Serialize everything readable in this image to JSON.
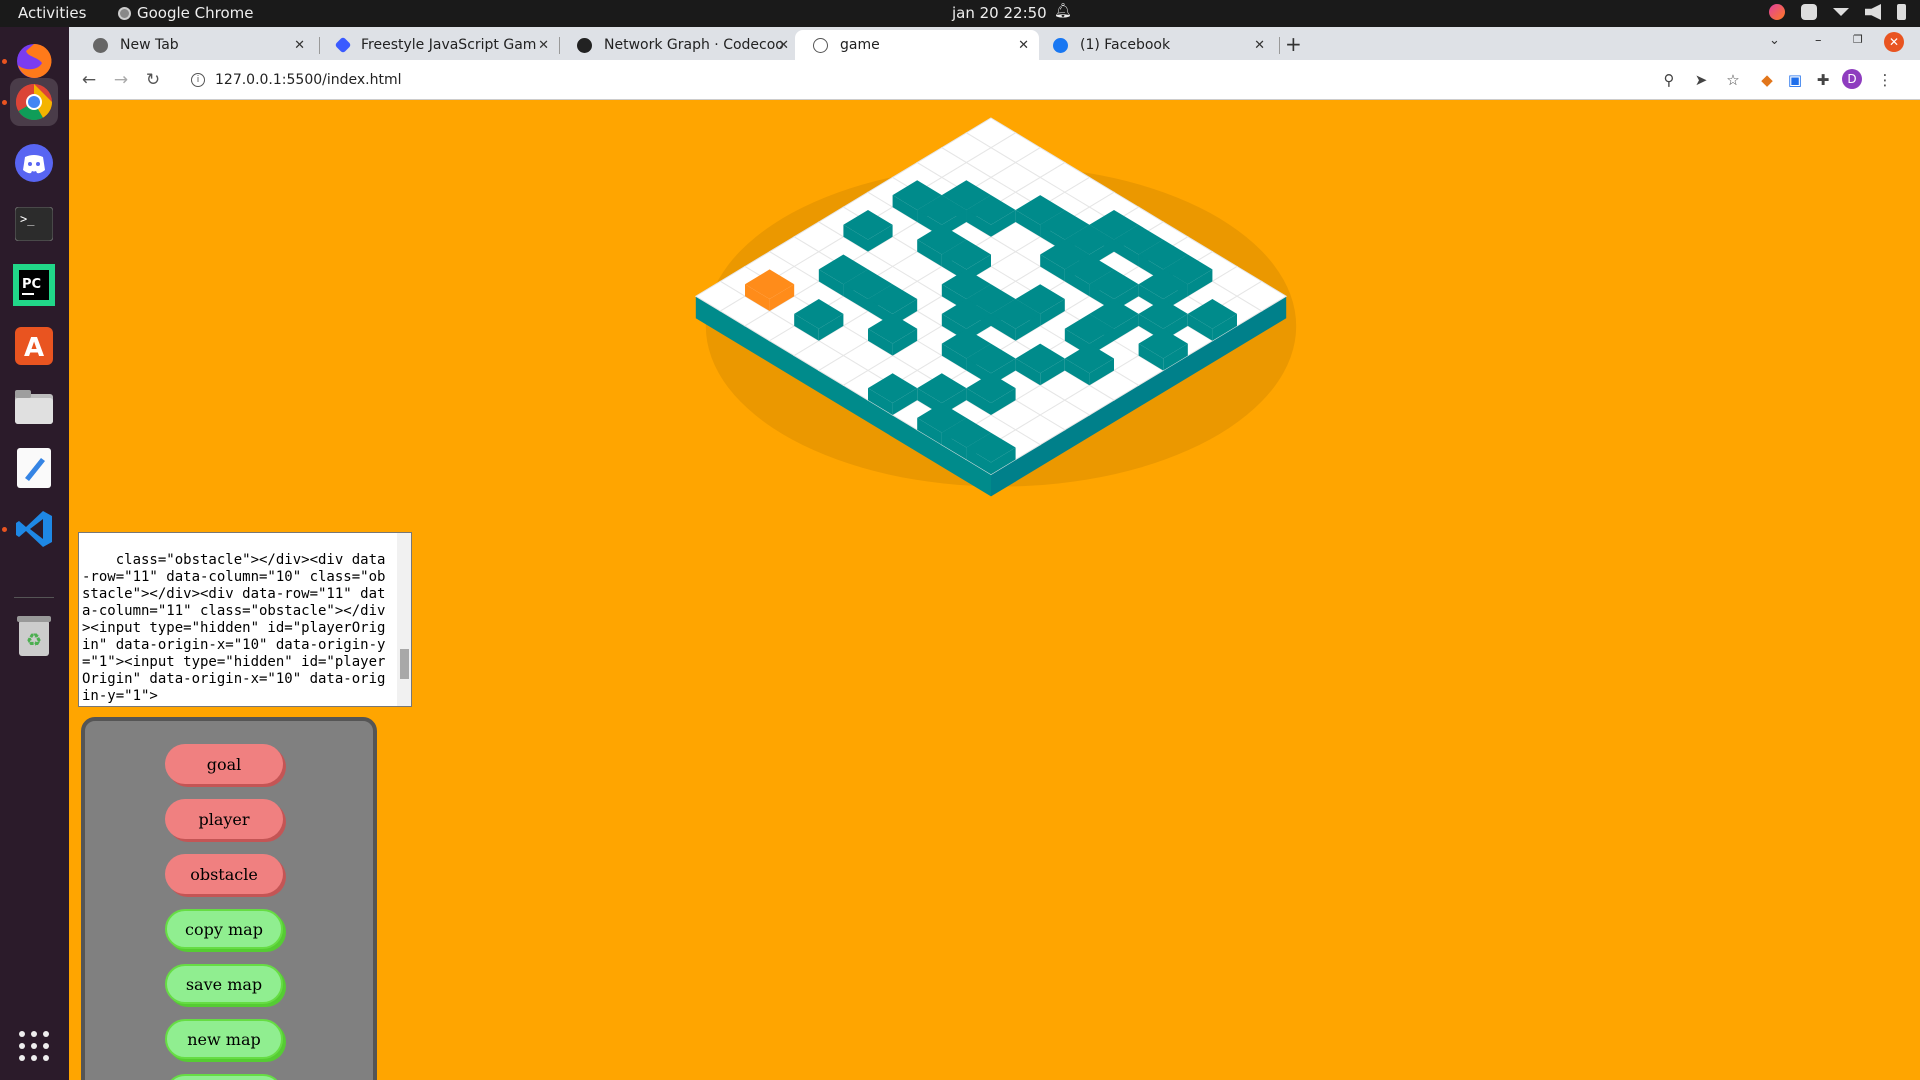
{
  "topbar": {
    "activities": "Activities",
    "app_name": "Google Chrome",
    "clock": "jan 20  22:50"
  },
  "dock": {
    "items": [
      "firefox-icon",
      "chrome-icon",
      "discord-icon",
      "terminal-icon",
      "pycharm-icon",
      "software-center-icon",
      "files-icon",
      "text-editor-icon",
      "vscode-icon",
      "trash-icon",
      "app-grid-icon"
    ]
  },
  "browser": {
    "tabs": [
      {
        "title": "New Tab",
        "icon": "chrome-tab-icon"
      },
      {
        "title": "Freestyle JavaScript Gam",
        "icon": "codecademy-icon"
      },
      {
        "title": "Network Graph · Codecoo",
        "icon": "github-icon"
      },
      {
        "title": "game",
        "icon": "globe-icon",
        "active": true
      },
      {
        "title": "(1) Facebook",
        "icon": "facebook-icon"
      }
    ],
    "new_tab": "+",
    "url": "127.0.0.1:5500/index.html",
    "profile_initial": "D"
  },
  "page": {
    "background": "#ffa500",
    "board": {
      "size": 12,
      "colors": {
        "floor": "#ffffff",
        "grid": "#e6e6e6",
        "wall": "#008b8b",
        "side": "#00808a",
        "player": "#ff8c1a"
      },
      "player": {
        "row": 10,
        "col": 1
      },
      "obstacles": [
        [
          1,
          6
        ],
        [
          1,
          7
        ],
        [
          1,
          8
        ],
        [
          1,
          9
        ],
        [
          2,
          4
        ],
        [
          2,
          5
        ],
        [
          2,
          6
        ],
        [
          2,
          9
        ],
        [
          2,
          11
        ],
        [
          3,
          2
        ],
        [
          3,
          3
        ],
        [
          3,
          6
        ],
        [
          3,
          7
        ],
        [
          3,
          8
        ],
        [
          3,
          10
        ],
        [
          4,
          1
        ],
        [
          4,
          2
        ],
        [
          4,
          9
        ],
        [
          4,
          11
        ],
        [
          5,
          3
        ],
        [
          5,
          4
        ],
        [
          5,
          7
        ],
        [
          5,
          9
        ],
        [
          6,
          1
        ],
        [
          6,
          5
        ],
        [
          6,
          6
        ],
        [
          6,
          7
        ],
        [
          6,
          10
        ],
        [
          7,
          6
        ],
        [
          7,
          9
        ],
        [
          8,
          2
        ],
        [
          8,
          3
        ],
        [
          8,
          4
        ],
        [
          8,
          7
        ],
        [
          8,
          8
        ],
        [
          9,
          5
        ],
        [
          9,
          9
        ],
        [
          10,
          3
        ],
        [
          10,
          8
        ],
        [
          11,
          7
        ],
        [
          11,
          9
        ],
        [
          11,
          10
        ],
        [
          11,
          11
        ]
      ]
    },
    "map_code": "class=\"obstacle\"></div><div data-row=\"11\" data-column=\"10\" class=\"obstacle\"></div><div data-row=\"11\" data-column=\"11\" class=\"obstacle\"></div><input type=\"hidden\" id=\"playerOrigin\" data-origin-x=\"10\" data-origin-y=\"1\"><input type=\"hidden\" id=\"playerOrigin\" data-origin-x=\"10\" data-origin-y=\"1\">",
    "palette": {
      "goal": "goal",
      "player": "player",
      "obstacle": "obstacle",
      "copy_map": "copy map",
      "save_map": "save map",
      "new_map": "new map"
    }
  }
}
